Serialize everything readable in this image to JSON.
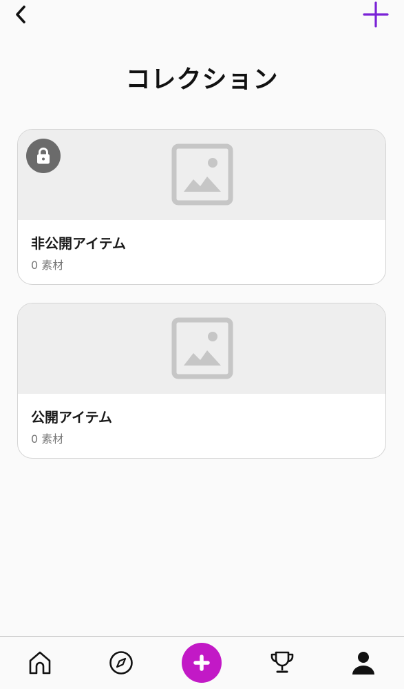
{
  "header": {
    "title": "コレクション",
    "back_icon": "chevron-left-icon",
    "add_icon": "plus-icon"
  },
  "collections": [
    {
      "name": "非公開アイテム",
      "count": "0 素材",
      "private": true,
      "badge_icon": "lock-icon",
      "thumbnail_icon": "image-placeholder-icon"
    },
    {
      "name": "公開アイテム",
      "count": "0 素材",
      "private": false,
      "thumbnail_icon": "image-placeholder-icon"
    }
  ],
  "bottom_nav": {
    "items": [
      {
        "icon": "home-icon"
      },
      {
        "icon": "compass-icon"
      },
      {
        "icon": "create-plus-icon"
      },
      {
        "icon": "trophy-icon"
      },
      {
        "icon": "user-profile-icon"
      }
    ]
  },
  "colors": {
    "accent": "#7a22d6",
    "create_button": "#c219c6",
    "placeholder": "#c6c6c6",
    "badge": "#6b6b6b"
  }
}
